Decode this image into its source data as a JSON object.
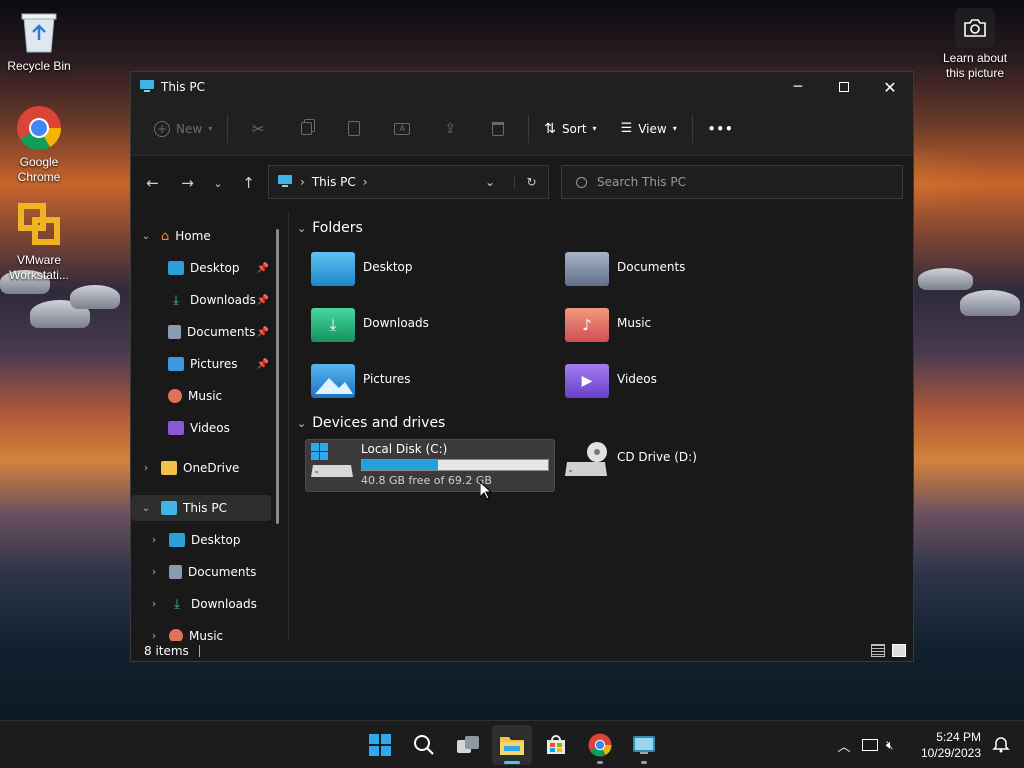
{
  "desktop": {
    "icons": [
      {
        "label": "Recycle Bin"
      },
      {
        "label": "Google Chrome"
      },
      {
        "label": "VMware Workstati..."
      }
    ],
    "spotlight_label": "Learn about this picture"
  },
  "window": {
    "title": "This PC",
    "commands": {
      "new": "New",
      "sort": "Sort",
      "view": "View",
      "more": "•••"
    },
    "address": {
      "crumb": "This PC"
    },
    "search": {
      "placeholder": "Search This PC"
    },
    "sidebar": {
      "home": "Home",
      "quick": [
        {
          "label": "Desktop",
          "pinned": true
        },
        {
          "label": "Downloads",
          "pinned": true
        },
        {
          "label": "Documents",
          "pinned": true
        },
        {
          "label": "Pictures",
          "pinned": true
        },
        {
          "label": "Music",
          "pinned": false
        },
        {
          "label": "Videos",
          "pinned": false
        }
      ],
      "onedrive": "OneDrive",
      "thispc": "This PC",
      "thispc_children": [
        "Desktop",
        "Documents",
        "Downloads",
        "Music"
      ]
    },
    "sections": {
      "folders": "Folders",
      "devices": "Devices and drives"
    },
    "folders": [
      "Desktop",
      "Documents",
      "Downloads",
      "Music",
      "Pictures",
      "Videos"
    ],
    "drives": {
      "c": {
        "name": "Local Disk (C:)",
        "free_text": "40.8 GB free of 69.2 GB",
        "used_fraction": 0.41
      },
      "d": {
        "name": "CD Drive (D:)"
      }
    },
    "status": {
      "items": "8 items"
    }
  },
  "taskbar": {
    "time": "5:24 PM",
    "date": "10/29/2023"
  },
  "colors": {
    "accent": "#4cc2ff",
    "drive_bar": "#26a0da",
    "window_bg": "#191919"
  }
}
